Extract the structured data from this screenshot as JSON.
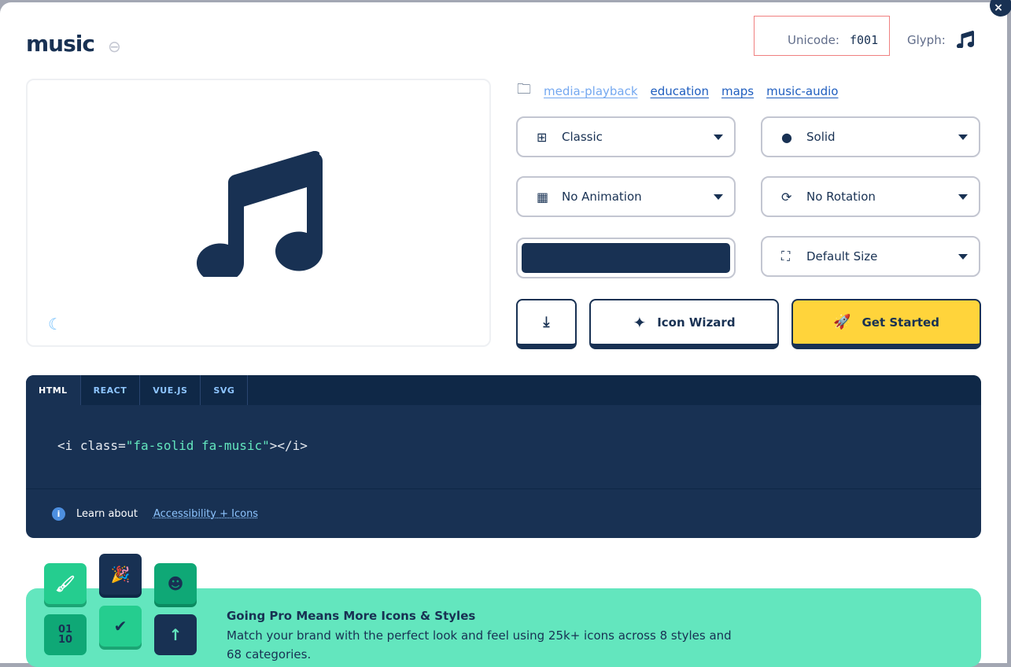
{
  "icon": {
    "name": "music",
    "unicode_label": "Unicode:",
    "unicode": "f001",
    "glyph_label": "Glyph:"
  },
  "categories": [
    "media-playback",
    "education",
    "maps",
    "music-audio"
  ],
  "controls": {
    "family": "Classic",
    "style": "Solid",
    "animation": "No Animation",
    "rotation": "No Rotation",
    "color": "#183153",
    "size": "Default Size"
  },
  "buttons": {
    "wizard": "Icon Wizard",
    "get_started": "Get Started"
  },
  "code": {
    "tabs": [
      "HTML",
      "REACT",
      "VUE.JS",
      "SVG"
    ],
    "snippet_open": "<i class=",
    "snippet_value": "\"fa-solid fa-music\"",
    "snippet_close": "></i>",
    "learn": "Learn about",
    "learn_link": "Accessibility + Icons"
  },
  "promo": {
    "title": "Going Pro Means More Icons & Styles",
    "text": "Match your brand with the perfect look and feel using 25k+ icons across 8 styles and 68 categories.",
    "binary_tile": "01 10"
  },
  "colors": {
    "navy": "#183153",
    "yellow": "#ffd43b",
    "mint": "#63e6be"
  }
}
